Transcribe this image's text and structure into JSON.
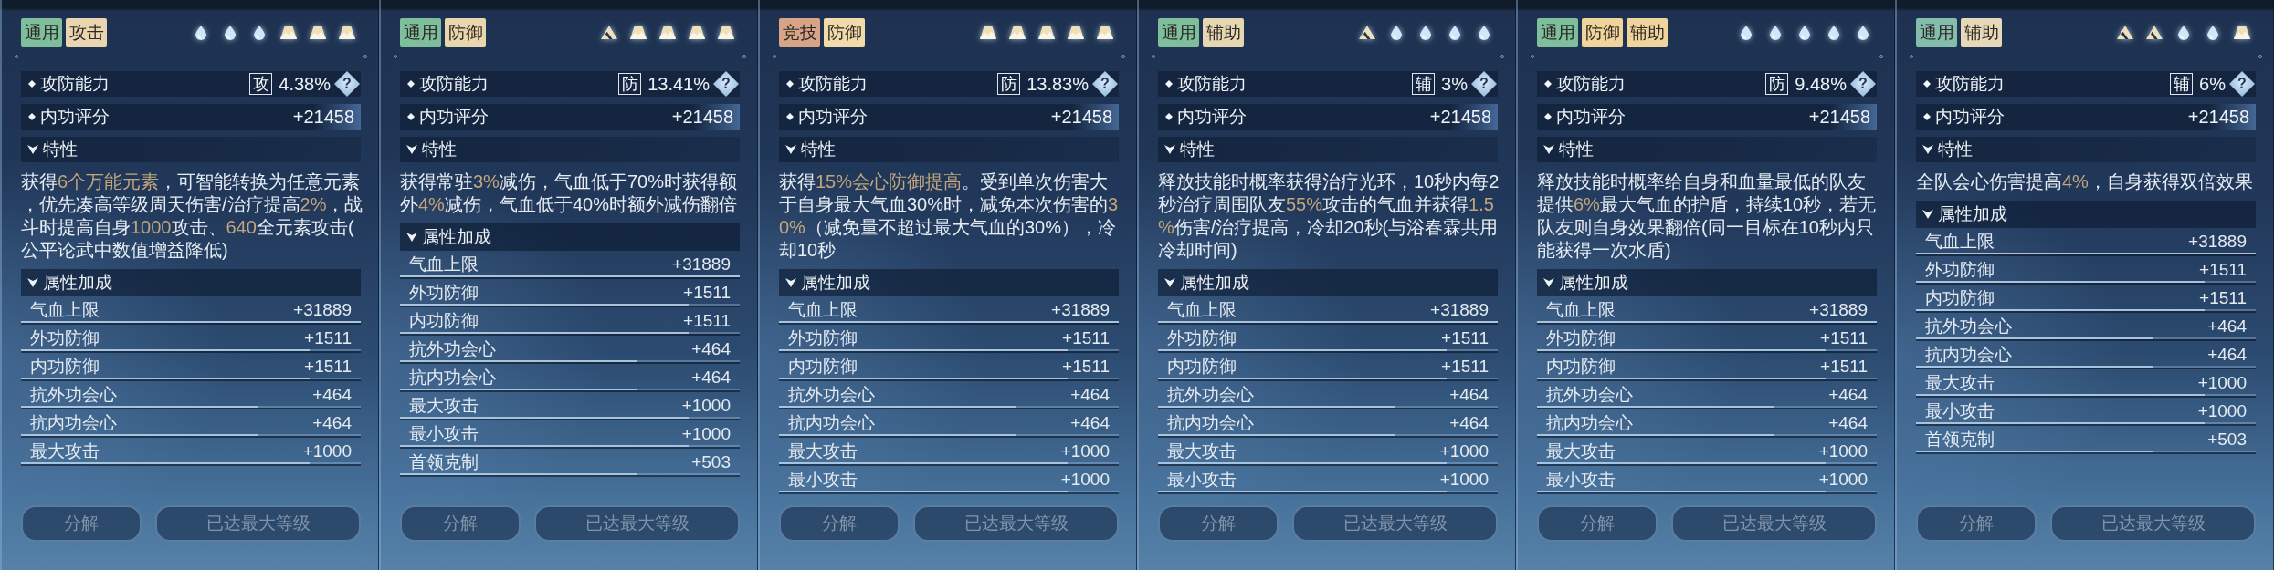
{
  "panels": [
    {
      "tags": [
        {
          "label": "通用",
          "color": "#7fbe9d"
        },
        {
          "label": "攻击",
          "color": "#e9d6b0"
        }
      ],
      "elements": [
        {
          "kind": "drop"
        },
        {
          "kind": "drop"
        },
        {
          "kind": "drop"
        },
        {
          "kind": "mountain"
        },
        {
          "kind": "mountain"
        },
        {
          "kind": "mountain"
        }
      ],
      "rating": {
        "label": "攻防能力",
        "type": "攻",
        "value": "4.38%",
        "help": "?"
      },
      "score": {
        "label": "内功评分",
        "value": "+21458"
      },
      "traits": {
        "title": "特性",
        "expanded": true,
        "text": "获得**6个万能元素**，可智能转换为任意元素，优先凑高等级周天伤害/治疗提高**2%**，战斗时提高自身**1000**攻击、**640**全元素攻击(公平论武中数值增益降低)"
      },
      "attributes": {
        "title": "属性加成",
        "expanded": true,
        "rows": [
          {
            "label": "气血上限",
            "value": "+31889",
            "level": 1
          },
          {
            "label": "外功防御",
            "value": "+1511",
            "level": 0.85
          },
          {
            "label": "内功防御",
            "value": "+1511",
            "level": 0.85
          },
          {
            "label": "抗外功会心",
            "value": "+464",
            "level": 0.7
          },
          {
            "label": "抗内功会心",
            "value": "+464",
            "level": 0.7
          },
          {
            "label": "最大攻击",
            "value": "+1000",
            "level": 0.85
          }
        ]
      },
      "buttons": [
        {
          "label": "分解",
          "disabled": true
        },
        {
          "label": "已达最大等级",
          "disabled": true
        }
      ]
    },
    {
      "tags": [
        {
          "label": "通用",
          "color": "#7fbe9d"
        },
        {
          "label": "防御",
          "color": "#ead6ac"
        }
      ],
      "elements": [
        {
          "kind": "triangle"
        },
        {
          "kind": "mountain"
        },
        {
          "kind": "mountain"
        },
        {
          "kind": "mountain"
        },
        {
          "kind": "mountain"
        }
      ],
      "rating": {
        "label": "攻防能力",
        "type": "防",
        "value": "13.41%",
        "help": "?"
      },
      "score": {
        "label": "内功评分",
        "value": "+21458"
      },
      "traits": {
        "title": "特性",
        "expanded": true,
        "text": "获得常驻**3%**减伤，气血低于70%时获得额外**4%**减伤，气血低于40%时额外减伤翻倍"
      },
      "attributes": {
        "title": "属性加成",
        "expanded": true,
        "rows": [
          {
            "label": "气血上限",
            "value": "+31889",
            "level": 1
          },
          {
            "label": "外功防御",
            "value": "+1511",
            "level": 0.85
          },
          {
            "label": "内功防御",
            "value": "+1511",
            "level": 0.85
          },
          {
            "label": "抗外功会心",
            "value": "+464",
            "level": 0.7
          },
          {
            "label": "抗内功会心",
            "value": "+464",
            "level": 0.7
          },
          {
            "label": "最大攻击",
            "value": "+1000",
            "level": 0.85
          },
          {
            "label": "最小攻击",
            "value": "+1000",
            "level": 0.85
          },
          {
            "label": "首领克制",
            "value": "+503",
            "level": 0.7
          }
        ]
      },
      "buttons": [
        {
          "label": "分解",
          "disabled": true
        },
        {
          "label": "已达最大等级",
          "disabled": true
        }
      ]
    },
    {
      "tags": [
        {
          "label": "竞技",
          "color": "#d8a487"
        },
        {
          "label": "防御",
          "color": "#f1dbab"
        }
      ],
      "elements": [
        {
          "kind": "mountain"
        },
        {
          "kind": "mountain"
        },
        {
          "kind": "mountain"
        },
        {
          "kind": "mountain"
        },
        {
          "kind": "mountain"
        }
      ],
      "rating": {
        "label": "攻防能力",
        "type": "防",
        "value": "13.83%",
        "help": "?"
      },
      "score": {
        "label": "内功评分",
        "value": "+21458"
      },
      "traits": {
        "title": "特性",
        "expanded": true,
        "text": "获得**15%会心防御提高**。受到单次伤害大于自身最大气血30%时，减免本次伤害的**30%**（减免量不超过最大气血的30%），冷却10秒"
      },
      "attributes": {
        "title": "属性加成",
        "expanded": true,
        "rows": [
          {
            "label": "气血上限",
            "value": "+31889",
            "level": 1
          },
          {
            "label": "外功防御",
            "value": "+1511",
            "level": 0.85
          },
          {
            "label": "内功防御",
            "value": "+1511",
            "level": 0.85
          },
          {
            "label": "抗外功会心",
            "value": "+464",
            "level": 0.7
          },
          {
            "label": "抗内功会心",
            "value": "+464",
            "level": 0.7
          },
          {
            "label": "最大攻击",
            "value": "+1000",
            "level": 0.85
          },
          {
            "label": "最小攻击",
            "value": "+1000",
            "level": 0.85
          }
        ]
      },
      "buttons": [
        {
          "label": "分解",
          "disabled": true
        },
        {
          "label": "已达最大等级",
          "disabled": true
        }
      ]
    },
    {
      "tags": [
        {
          "label": "通用",
          "color": "#7fbe9d"
        },
        {
          "label": "辅助",
          "color": "#e6d7b3"
        }
      ],
      "elements": [
        {
          "kind": "triangle"
        },
        {
          "kind": "drop"
        },
        {
          "kind": "drop"
        },
        {
          "kind": "drop"
        },
        {
          "kind": "drop"
        }
      ],
      "rating": {
        "label": "攻防能力",
        "type": "辅",
        "value": "3%",
        "help": "?"
      },
      "score": {
        "label": "内功评分",
        "value": "+21458"
      },
      "traits": {
        "title": "特性",
        "expanded": true,
        "text": "释放技能时概率获得治疗光环，10秒内每2秒治疗周围队友**55%**攻击的气血并获得**1.5%**伤害/治疗提高，冷却20秒(与浴春霖共用冷却时间)"
      },
      "attributes": {
        "title": "属性加成",
        "expanded": true,
        "rows": [
          {
            "label": "气血上限",
            "value": "+31889",
            "level": 1
          },
          {
            "label": "外功防御",
            "value": "+1511",
            "level": 0.85
          },
          {
            "label": "内功防御",
            "value": "+1511",
            "level": 0.85
          },
          {
            "label": "抗外功会心",
            "value": "+464",
            "level": 0.7
          },
          {
            "label": "抗内功会心",
            "value": "+464",
            "level": 0.7
          },
          {
            "label": "最大攻击",
            "value": "+1000",
            "level": 0.85
          },
          {
            "label": "最小攻击",
            "value": "+1000",
            "level": 0.85
          }
        ]
      },
      "buttons": [
        {
          "label": "分解",
          "disabled": true
        },
        {
          "label": "已达最大等级",
          "disabled": true
        }
      ]
    },
    {
      "tags": [
        {
          "label": "通用",
          "color": "#7fbe9d"
        },
        {
          "label": "防御",
          "color": "#f1d49c"
        },
        {
          "label": "辅助",
          "color": "#f1d49c"
        }
      ],
      "elements": [
        {
          "kind": "drop"
        },
        {
          "kind": "drop"
        },
        {
          "kind": "drop"
        },
        {
          "kind": "drop"
        },
        {
          "kind": "drop"
        }
      ],
      "rating": {
        "label": "攻防能力",
        "type": "防",
        "value": "9.48%",
        "help": "?"
      },
      "score": {
        "label": "内功评分",
        "value": "+21458"
      },
      "traits": {
        "title": "特性",
        "expanded": true,
        "text": "释放技能时概率给自身和血量最低的队友提供**6%**最大气血的护盾，持续10秒，若无队友则自身效果翻倍(同一目标在10秒内只能获得一次水盾)"
      },
      "attributes": {
        "title": "属性加成",
        "expanded": true,
        "rows": [
          {
            "label": "气血上限",
            "value": "+31889",
            "level": 1
          },
          {
            "label": "外功防御",
            "value": "+1511",
            "level": 0.85
          },
          {
            "label": "内功防御",
            "value": "+1511",
            "level": 0.85
          },
          {
            "label": "抗外功会心",
            "value": "+464",
            "level": 0.7
          },
          {
            "label": "抗内功会心",
            "value": "+464",
            "level": 0.7
          },
          {
            "label": "最大攻击",
            "value": "+1000",
            "level": 0.85
          },
          {
            "label": "最小攻击",
            "value": "+1000",
            "level": 0.85
          }
        ]
      },
      "buttons": [
        {
          "label": "分解",
          "disabled": true
        },
        {
          "label": "已达最大等级",
          "disabled": true
        }
      ]
    },
    {
      "tags": [
        {
          "label": "通用",
          "color": "#85bdad"
        },
        {
          "label": "辅助",
          "color": "#e7d8b7"
        }
      ],
      "elements": [
        {
          "kind": "triangle"
        },
        {
          "kind": "triangle"
        },
        {
          "kind": "drop"
        },
        {
          "kind": "drop"
        },
        {
          "kind": "mountain"
        }
      ],
      "rating": {
        "label": "攻防能力",
        "type": "辅",
        "value": "6%",
        "help": "?"
      },
      "score": {
        "label": "内功评分",
        "value": "+21458"
      },
      "traits": {
        "title": "特性",
        "expanded": true,
        "text": "全队会心伤害提高**4%**，自身获得双倍效果"
      },
      "attributes": {
        "title": "属性加成",
        "expanded": true,
        "rows": [
          {
            "label": "气血上限",
            "value": "+31889",
            "level": 1
          },
          {
            "label": "外功防御",
            "value": "+1511",
            "level": 0.85
          },
          {
            "label": "内功防御",
            "value": "+1511",
            "level": 0.85
          },
          {
            "label": "抗外功会心",
            "value": "+464",
            "level": 0.7
          },
          {
            "label": "抗内功会心",
            "value": "+464",
            "level": 0.7
          },
          {
            "label": "最大攻击",
            "value": "+1000",
            "level": 0.85
          },
          {
            "label": "最小攻击",
            "value": "+1000",
            "level": 0.85
          },
          {
            "label": "首领克制",
            "value": "+503",
            "level": 0.7
          }
        ]
      },
      "buttons": [
        {
          "label": "分解",
          "disabled": true
        },
        {
          "label": "已达最大等级",
          "disabled": true
        }
      ]
    }
  ]
}
